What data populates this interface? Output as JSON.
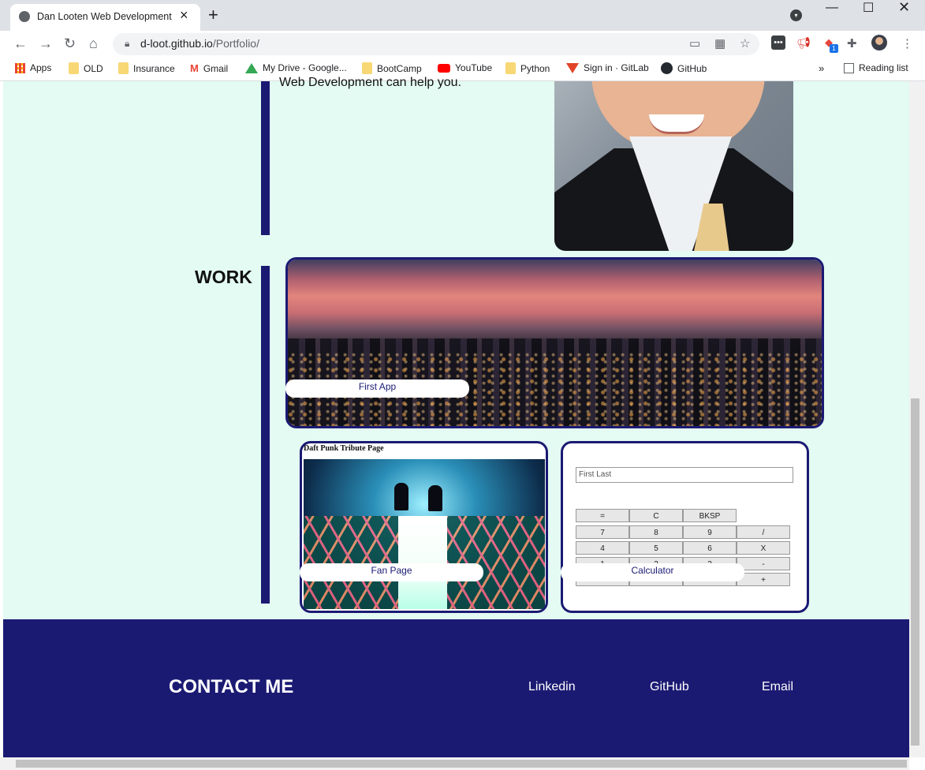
{
  "browser": {
    "tab_title": "Dan Looten Web Development",
    "url_host": "d-loot.github.io",
    "url_path": "/Portfolio/",
    "bookmarks": [
      {
        "label": "Apps",
        "icon": "apps-grid-icon"
      },
      {
        "label": "OLD",
        "icon": "folder-icon"
      },
      {
        "label": "Insurance",
        "icon": "folder-icon"
      },
      {
        "label": "Gmail",
        "icon": "gmail-icon"
      },
      {
        "label": "My Drive - Google...",
        "icon": "drive-icon"
      },
      {
        "label": "BootCamp",
        "icon": "folder-icon"
      },
      {
        "label": "YouTube",
        "icon": "youtube-icon"
      },
      {
        "label": "Python",
        "icon": "folder-icon"
      },
      {
        "label": "Sign in · GitLab",
        "icon": "gitlab-icon"
      },
      {
        "label": "GitHub",
        "icon": "github-icon"
      }
    ],
    "reading_list": "Reading list",
    "extension_badge": "1"
  },
  "page": {
    "about_text": "Web Development can help you.",
    "work_title": "WORK",
    "projects": [
      {
        "label": "First App"
      },
      {
        "label": "Fan Page",
        "heading": "Daft Punk Tribute Page"
      },
      {
        "label": "Calculator",
        "name_placeholder": "First Last",
        "keys": [
          "=",
          "C",
          "BKSP",
          "7",
          "8",
          "9",
          "/",
          "4",
          "5",
          "6",
          "X",
          "1",
          "2",
          "3",
          "-",
          "+"
        ]
      }
    ]
  },
  "footer": {
    "contact_title": "CONTACT ME",
    "links": [
      "Linkedin",
      "GitHub",
      "Email"
    ]
  },
  "colors": {
    "page_bg": "#e3fbf2",
    "accent_navy": "#1b1a73"
  }
}
